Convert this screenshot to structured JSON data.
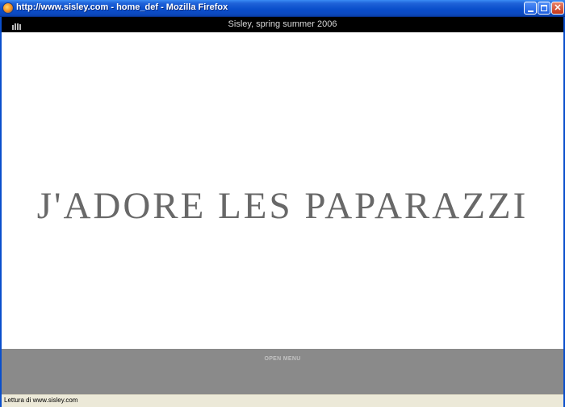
{
  "window": {
    "title": "http://www.sisley.com - home_def - Mozilla Firefox"
  },
  "site": {
    "header_title": "Sisley, spring summer 2006",
    "headline": "J'ADORE LES PAPARAZZI",
    "menu_label": "OPEN MENU"
  },
  "status": {
    "text": "Lettura di www.sisley.com"
  },
  "colors": {
    "header_bg": "#000000",
    "menu_bg": "#8a8a8a",
    "headline": "#686868"
  }
}
